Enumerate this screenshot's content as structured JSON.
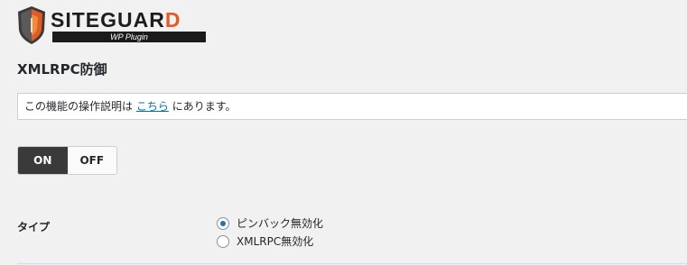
{
  "logo": {
    "name_main": "SITEGUAR",
    "name_accent": "D",
    "subtitle": "WP Plugin",
    "brand_color": "#e45a24",
    "icon": "shield-logo-icon"
  },
  "page": {
    "title": "XMLRPC防御"
  },
  "notice": {
    "text_before": "この機能の操作説明は",
    "link_text": "こちら",
    "text_after": "にあります。",
    "link_color": "#0073aa"
  },
  "toggle": {
    "on_label": "ON",
    "off_label": "OFF",
    "selected": "ON"
  },
  "type_setting": {
    "label": "タイプ",
    "options": [
      {
        "label": "ピンバック無効化",
        "checked": true
      },
      {
        "label": "XMLRPC無効化",
        "checked": false
      }
    ]
  }
}
